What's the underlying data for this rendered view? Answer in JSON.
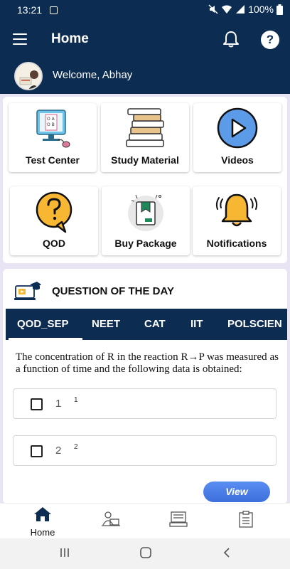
{
  "status": {
    "time": "13:21",
    "battery": "100%"
  },
  "header": {
    "title": "Home",
    "welcome": "Welcome, Abhay"
  },
  "tiles": [
    {
      "label": "Test Center"
    },
    {
      "label": "Study Material"
    },
    {
      "label": "Videos"
    },
    {
      "label": "QOD"
    },
    {
      "label": "Buy Package"
    },
    {
      "label": "Notifications"
    }
  ],
  "qod": {
    "title": "QUESTION OF THE DAY",
    "tabs": [
      "QOD_SEP",
      "NEET",
      "CAT",
      "IIT",
      "POLSCIEN"
    ],
    "active_tab": "QOD_SEP",
    "question": "The concentration of R in the reaction R→P was measured as a function of time and the following data is obtained:",
    "options": [
      {
        "num": "1",
        "sup": "1"
      },
      {
        "num": "2",
        "sup": "2"
      }
    ],
    "view_label": "View"
  },
  "bottom_nav": {
    "home_label": "Home"
  },
  "colors": {
    "primary": "#0d2c52",
    "accent": "#3c6fdc",
    "background": "#e9e4f4"
  }
}
